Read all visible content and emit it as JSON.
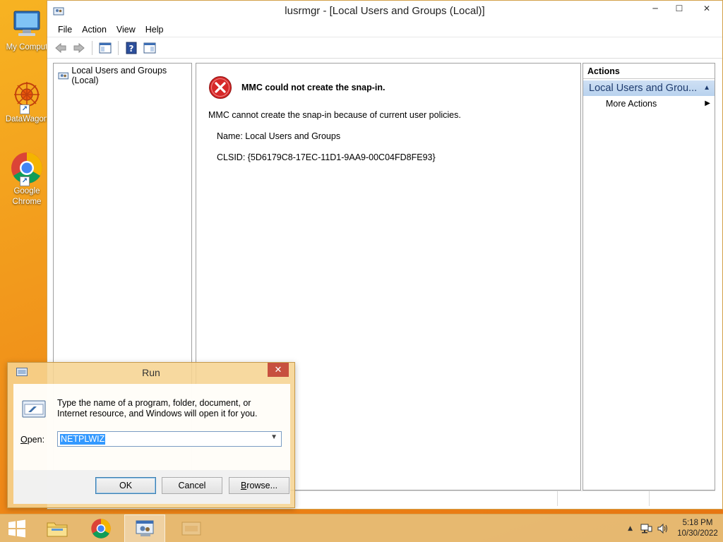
{
  "desktop": {
    "icons": [
      {
        "label": "My Comput"
      },
      {
        "label": "DataWagon"
      },
      {
        "label": "Google Chrome"
      }
    ]
  },
  "mmc": {
    "title": "lusrmgr - [Local Users and Groups (Local)]",
    "window_buttons": {
      "minimize": "─",
      "maximize": "☐",
      "close": "✕"
    },
    "menu": [
      "File",
      "Action",
      "View",
      "Help"
    ],
    "tree": {
      "root_label": "Local Users and Groups (Local)"
    },
    "center": {
      "error_title": "MMC could not create the snap-in.",
      "message": "MMC cannot create the snap-in because of current user policies.",
      "name_line": "Name: Local Users and Groups",
      "clsid_line": "CLSID: {5D6179C8-17EC-11D1-9AA9-00C04FD8FE93}"
    },
    "actions": {
      "header": "Actions",
      "group_label": "Local Users and Grou...",
      "more_actions": "More Actions"
    }
  },
  "run_dialog": {
    "title": "Run",
    "close_glyph": "✕",
    "description": "Type the name of a program, folder, document, or Internet resource, and Windows will open it for you.",
    "open_label_accel": "O",
    "open_label_rest": "pen:",
    "open_value": "NETPLWIZ",
    "ok_label": "OK",
    "cancel_label": "Cancel",
    "browse_accel": "B",
    "browse_rest": "rowse..."
  },
  "taskbar": {
    "time": "5:18 PM",
    "date": "10/30/2022"
  },
  "colors": {
    "desktop_accent": "#f29a1c",
    "error_red": "#d62828",
    "selection_blue": "#3399ff",
    "actions_header_blue": "#b9d2ee"
  }
}
